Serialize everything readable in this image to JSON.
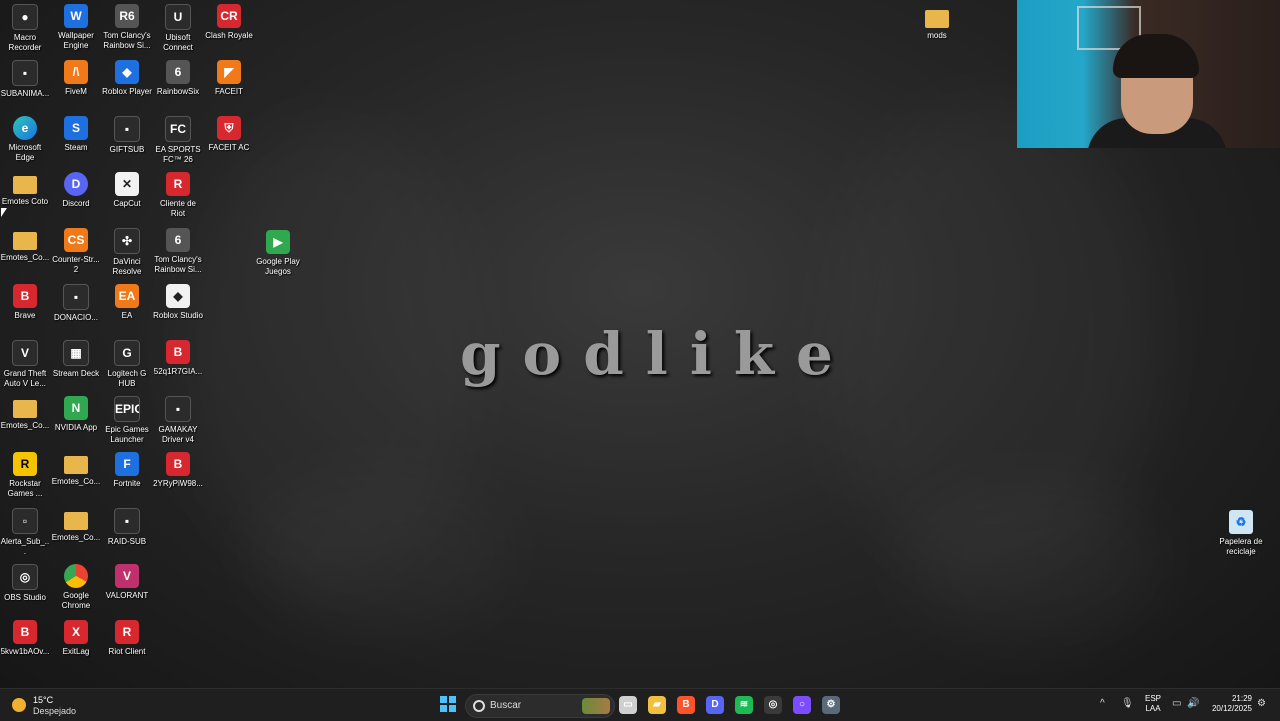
{
  "wallpaper": {
    "text": "godlike"
  },
  "desktop": {
    "col1": [
      {
        "label": "Macro Recorder",
        "icon": "macro-recorder-icon",
        "glyph": "●"
      },
      {
        "label": "SUBANIMA...",
        "icon": "file-icon",
        "glyph": "▪"
      },
      {
        "label": "Microsoft Edge",
        "icon": "edge-icon",
        "glyph": "e"
      },
      {
        "label": "Emotes Coto",
        "icon": "folder-icon",
        "glyph": ""
      },
      {
        "label": "Emotes_Co...",
        "icon": "folder-icon",
        "glyph": ""
      },
      {
        "label": "Brave",
        "icon": "brave-icon",
        "glyph": "B"
      },
      {
        "label": "Grand Theft Auto V Le...",
        "icon": "gta-icon",
        "glyph": "V"
      },
      {
        "label": "Emotes_Co...",
        "icon": "folder-icon",
        "glyph": ""
      },
      {
        "label": "Rockstar Games ...",
        "icon": "rockstar-icon",
        "glyph": "R"
      },
      {
        "label": "Alerta_Sub_...",
        "icon": "file-icon",
        "glyph": "▫"
      },
      {
        "label": "OBS Studio",
        "icon": "obs-icon",
        "glyph": "◎"
      },
      {
        "label": "5kvw1bAOv...",
        "icon": "brave-icon",
        "glyph": "B"
      }
    ],
    "col2": [
      {
        "label": "Wallpaper Engine",
        "icon": "wallpaper-engine-icon",
        "glyph": "W"
      },
      {
        "label": "FiveM",
        "icon": "fivem-icon",
        "glyph": "/\\"
      },
      {
        "label": "Steam",
        "icon": "steam-icon",
        "glyph": "S"
      },
      {
        "label": "Discord",
        "icon": "discord-icon",
        "glyph": "D"
      },
      {
        "label": "Counter-Str... 2",
        "icon": "counter-strike-icon",
        "glyph": "CS"
      },
      {
        "label": "DONACIO...",
        "icon": "file-icon",
        "glyph": "▪"
      },
      {
        "label": "Stream Deck",
        "icon": "stream-deck-icon",
        "glyph": "▦"
      },
      {
        "label": "NVIDIA App",
        "icon": "nvidia-icon",
        "glyph": "N"
      },
      {
        "label": "Emotes_Co...",
        "icon": "folder-icon",
        "glyph": ""
      },
      {
        "label": "Emotes_Co...",
        "icon": "folder-icon",
        "glyph": ""
      },
      {
        "label": "Google Chrome",
        "icon": "chrome-icon",
        "glyph": ""
      },
      {
        "label": "ExitLag",
        "icon": "exitlag-icon",
        "glyph": "X"
      }
    ],
    "col3": [
      {
        "label": "Tom Clancy's Rainbow Si...",
        "icon": "rainbow-six-icon",
        "glyph": "R6"
      },
      {
        "label": "Roblox Player",
        "icon": "roblox-icon",
        "glyph": "◆"
      },
      {
        "label": "GIFTSUB",
        "icon": "file-icon",
        "glyph": "▪"
      },
      {
        "label": "CapCut",
        "icon": "capcut-icon",
        "glyph": "✕"
      },
      {
        "label": "DaVinci Resolve",
        "icon": "davinci-icon",
        "glyph": "✣"
      },
      {
        "label": "EA",
        "icon": "ea-icon",
        "glyph": "EA"
      },
      {
        "label": "Logitech G HUB",
        "icon": "logitech-icon",
        "glyph": "G"
      },
      {
        "label": "Epic Games Launcher",
        "icon": "epic-games-icon",
        "glyph": "EPIC"
      },
      {
        "label": "Fortnite",
        "icon": "fortnite-icon",
        "glyph": "F"
      },
      {
        "label": "RAID-SUB",
        "icon": "file-icon",
        "glyph": "▪"
      },
      {
        "label": "VALORANT",
        "icon": "valorant-icon",
        "glyph": "V"
      },
      {
        "label": "Riot Client",
        "icon": "riot-icon",
        "glyph": "R"
      }
    ],
    "col4": [
      {
        "label": "Ubisoft Connect",
        "icon": "ubisoft-icon",
        "glyph": "U"
      },
      {
        "label": "RainbowSix",
        "icon": "rainbow-six-icon",
        "glyph": "6"
      },
      {
        "label": "EA SPORTS FC™ 26",
        "icon": "ea-fc-icon",
        "glyph": "FC"
      },
      {
        "label": "Cliente de Riot",
        "icon": "riot-icon",
        "glyph": "R"
      },
      {
        "label": "Tom Clancy's Rainbow Si...",
        "icon": "rainbow-six-icon",
        "glyph": "6"
      },
      {
        "label": "Roblox Studio",
        "icon": "roblox-studio-icon",
        "glyph": "◆"
      },
      {
        "label": "52q1R7GIA...",
        "icon": "brave-icon",
        "glyph": "B"
      },
      {
        "label": "GAMAKAY Driver v4",
        "icon": "gamakay-icon",
        "glyph": "▪"
      },
      {
        "label": "2YRyPiW98...",
        "icon": "brave-icon",
        "glyph": "B"
      }
    ],
    "col5": [
      {
        "label": "Clash Royale",
        "icon": "clash-royale-icon",
        "glyph": "CR"
      },
      {
        "label": "FACEIT",
        "icon": "faceit-icon",
        "glyph": "◤"
      },
      {
        "label": "FACEIT AC",
        "icon": "faceit-ac-icon",
        "glyph": "⛨"
      }
    ],
    "google_play": {
      "label": "Google Play Juegos",
      "icon": "google-play-games-icon",
      "glyph": "▶"
    },
    "mods": {
      "label": "mods",
      "icon": "folder-icon"
    },
    "recycle": {
      "label": "Papelera de reciclaje",
      "icon": "recycle-bin-icon",
      "glyph": "♻"
    }
  },
  "taskbar": {
    "weather": {
      "temp": "15°C",
      "condition": "Despejado",
      "icon": "moon-icon"
    },
    "search_placeholder": "Buscar",
    "pinned": [
      {
        "name": "task-view-icon",
        "glyph": "▭",
        "color": "#cfcfcf"
      },
      {
        "name": "file-explorer-icon",
        "glyph": "▰",
        "color": "#f0c040"
      },
      {
        "name": "brave-icon",
        "glyph": "B",
        "color": "#fb542b"
      },
      {
        "name": "discord-icon",
        "glyph": "D",
        "color": "#5865f2"
      },
      {
        "name": "spotify-icon",
        "glyph": "≋",
        "color": "#1db954"
      },
      {
        "name": "obs-icon",
        "glyph": "◎",
        "color": "#3a3a3a"
      },
      {
        "name": "twitch-studio-icon",
        "glyph": "○",
        "color": "#7c4dff"
      },
      {
        "name": "settings-icon",
        "glyph": "⚙",
        "color": "#5a6a7a"
      }
    ],
    "tray": {
      "chevron": "^",
      "mic": "🎙",
      "lang_top": "ESP",
      "lang_bottom": "LAA",
      "net": "▭",
      "vol": "🔊"
    },
    "clock": {
      "time": "21:29",
      "date": "20/12/2025"
    }
  }
}
